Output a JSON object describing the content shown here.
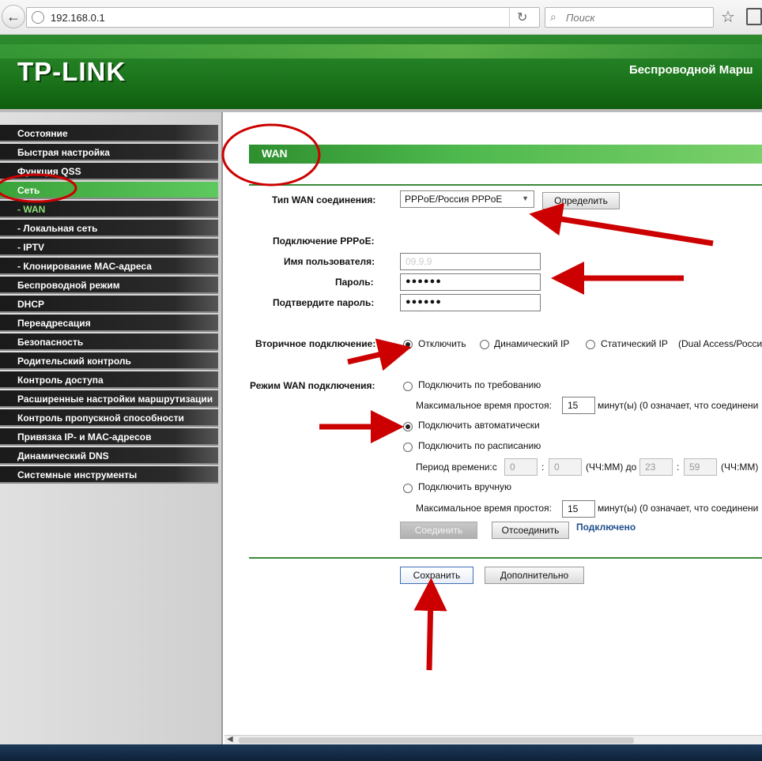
{
  "browser": {
    "url": "192.168.0.1",
    "search_placeholder": "Поиск"
  },
  "header": {
    "logo": "TP-LINK",
    "product": "Беспроводной Марш"
  },
  "sidebar": {
    "items": [
      {
        "label": "Состояние",
        "state": "normal"
      },
      {
        "label": "Быстрая настройка",
        "state": "normal"
      },
      {
        "label": "Функция QSS",
        "state": "normal"
      },
      {
        "label": "Сеть",
        "state": "active"
      },
      {
        "label": "- WAN",
        "state": "sub-active"
      },
      {
        "label": "- Локальная сеть",
        "state": "normal"
      },
      {
        "label": "- IPTV",
        "state": "normal"
      },
      {
        "label": "- Клонирование МАС-адреса",
        "state": "normal"
      },
      {
        "label": "Беспроводной режим",
        "state": "normal"
      },
      {
        "label": "DHCP",
        "state": "normal"
      },
      {
        "label": "Переадресация",
        "state": "normal"
      },
      {
        "label": "Безопасность",
        "state": "normal"
      },
      {
        "label": "Родительский контроль",
        "state": "normal"
      },
      {
        "label": "Контроль доступа",
        "state": "normal"
      },
      {
        "label": "Расширенные настройки маршрутизации",
        "state": "normal"
      },
      {
        "label": "Контроль пропускной способности",
        "state": "normal"
      },
      {
        "label": "Привязка IP- и МАС-адресов",
        "state": "normal"
      },
      {
        "label": "Динамический DNS",
        "state": "normal"
      },
      {
        "label": "Системные инструменты",
        "state": "normal"
      }
    ]
  },
  "page": {
    "title": "WAN",
    "wan_type_label": "Тип WAN соединения:",
    "wan_type_value": "PPPoE/Россия PPPoE",
    "detect_button": "Определить",
    "pppoe_label": "Подключение PPPoE:",
    "username_label": "Имя пользователя:",
    "username_value": "09,9,9",
    "password_label": "Пароль:",
    "password_value": "●●●●●●",
    "confirm_label": "Подтвердите пароль:",
    "confirm_value": "●●●●●●",
    "secondary_label": "Вторичное подключение:",
    "secondary_options": [
      "Отключить",
      "Динамический IP",
      "Статический IP"
    ],
    "secondary_selected": 0,
    "secondary_note": "(Dual Access/Росси",
    "mode_label": "Режим WAN подключения:",
    "mode_on_demand": "Подключить по требованию",
    "idle_label": "Максимальное время простоя:",
    "idle_value_1": "15",
    "idle_suffix": "минут(ы) (0 означает, что соединени",
    "mode_auto": "Подключить автоматически",
    "mode_schedule": "Подключить по расписанию",
    "period_label": "Период времени:с",
    "time_from_h": "0",
    "time_from_m": "0",
    "colon": ":",
    "hhmm_to": "(ЧЧ:ММ) до",
    "time_to_h": "23",
    "time_to_m": "59",
    "hhmm": "(ЧЧ:ММ)",
    "mode_manual": "Подключить вручную",
    "idle_value_2": "15",
    "connect_button": "Соединить",
    "disconnect_button": "Отсоединить",
    "status": "Подключено",
    "mode_selected": 1,
    "save_button": "Сохранить",
    "advanced_button": "Дополнительно"
  },
  "colors": {
    "brand_green": "#2e8b2e",
    "annotation_red": "#cc0000",
    "status_blue": "#1e4e8c"
  }
}
